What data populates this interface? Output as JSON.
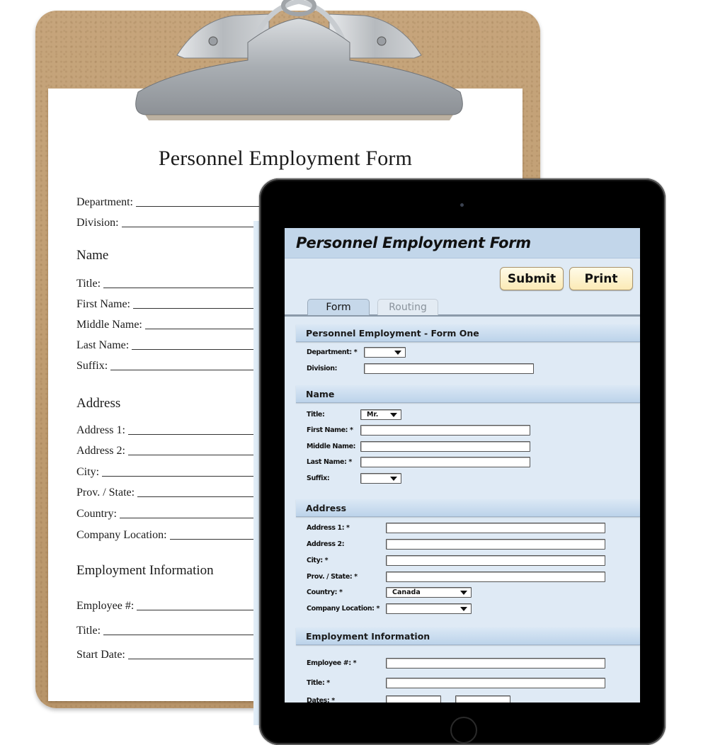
{
  "paper_form": {
    "title": "Personnel Employment Form",
    "top_fields": [
      {
        "label": "Department:"
      },
      {
        "label": "Division:"
      }
    ],
    "sections": [
      {
        "heading": "Name",
        "fields": [
          {
            "label": "Title:"
          },
          {
            "label": "First Name:"
          },
          {
            "label": "Middle Name:"
          },
          {
            "label": "Last Name:"
          },
          {
            "label": "Suffix:"
          }
        ]
      },
      {
        "heading": "Address",
        "fields": [
          {
            "label": "Address 1:"
          },
          {
            "label": "Address 2:"
          },
          {
            "label": "City:"
          },
          {
            "label": "Prov. / State:"
          },
          {
            "label": "Country:"
          },
          {
            "label": "Company Location:"
          }
        ]
      },
      {
        "heading": "Employment Information",
        "fields": [
          {
            "label": "Employee #:"
          },
          {
            "label": "Title:"
          },
          {
            "label": "Start Date:"
          }
        ]
      }
    ]
  },
  "tablet_app": {
    "title": "Personnel Employment Form",
    "toolbar": {
      "submit_label": "Submit",
      "print_label": "Print"
    },
    "tabs": [
      {
        "label": "Form",
        "active": true
      },
      {
        "label": "Routing",
        "active": false
      }
    ],
    "sections": {
      "form_one": {
        "heading": "Personnel Employment - Form One",
        "department": {
          "label": "Department: *",
          "value": ""
        },
        "division": {
          "label": "Division:",
          "value": ""
        }
      },
      "name": {
        "heading": "Name",
        "title": {
          "label": "Title:",
          "value": "Mr."
        },
        "first_name": {
          "label": "First Name: *",
          "value": ""
        },
        "middle_name": {
          "label": "Middle Name:",
          "value": ""
        },
        "last_name": {
          "label": "Last Name: *",
          "value": ""
        },
        "suffix": {
          "label": "Suffix:",
          "value": ""
        }
      },
      "address": {
        "heading": "Address",
        "address1": {
          "label": "Address 1: *",
          "value": ""
        },
        "address2": {
          "label": "Address 2:",
          "value": ""
        },
        "city": {
          "label": "City: *",
          "value": ""
        },
        "prov_state": {
          "label": "Prov. / State: *",
          "value": ""
        },
        "country": {
          "label": "Country: *",
          "value": "Canada"
        },
        "company_location": {
          "label": "Company Location: *",
          "value": ""
        }
      },
      "employment": {
        "heading": "Employment Information",
        "employee_number": {
          "label": "Employee #: *",
          "value": ""
        },
        "title": {
          "label": "Title: *",
          "value": ""
        },
        "dates": {
          "label": "Dates: *",
          "start": "",
          "end": ""
        }
      }
    },
    "colors": {
      "header_bg": "#c2d6ea",
      "screen_bg": "#dfeaf5",
      "button_bg": "#fbeab6",
      "clipboard": "#c0a071"
    }
  }
}
